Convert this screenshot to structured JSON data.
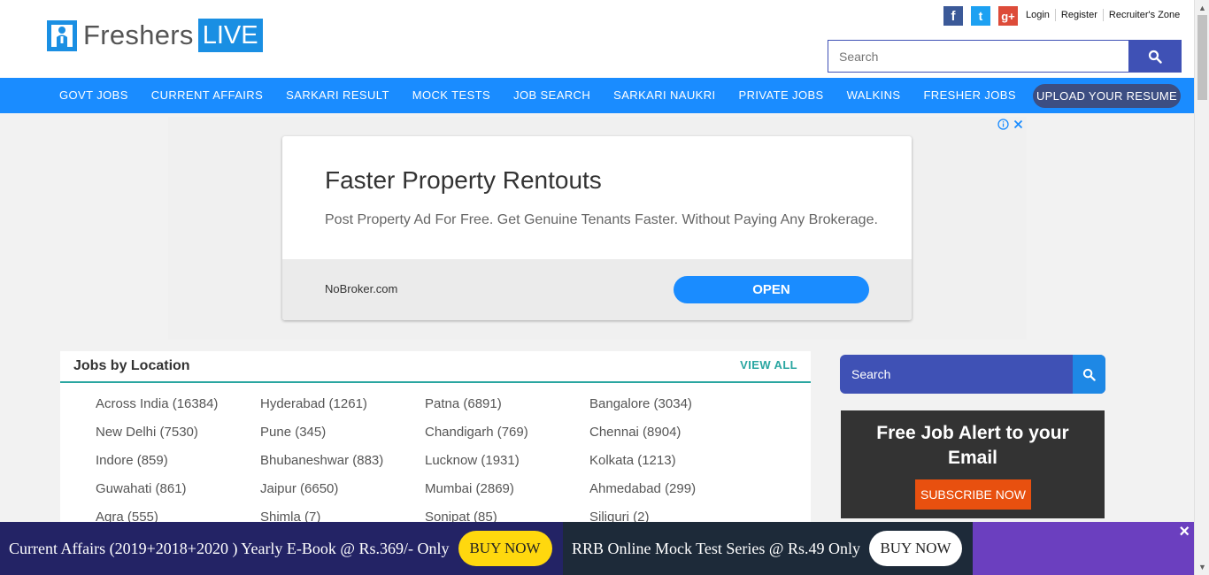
{
  "header": {
    "logo_text": "Freshers",
    "logo_badge": "LIVE",
    "social": [
      "facebook-icon",
      "twitter-icon",
      "google-plus-icon"
    ],
    "social_glyphs": [
      "f",
      "t",
      "g+"
    ],
    "social_colors": [
      "#3b5998",
      "#1da1f2",
      "#dd4b39"
    ],
    "links": [
      "Login",
      "Register",
      "Recruiter's Zone"
    ],
    "search_placeholder": "Search"
  },
  "nav": {
    "items": [
      "GOVT JOBS",
      "CURRENT AFFAIRS",
      "SARKARI RESULT",
      "MOCK TESTS",
      "JOB SEARCH",
      "SARKARI NAUKRI",
      "PRIVATE JOBS",
      "WALKINS",
      "FRESHER JOBS"
    ],
    "upload_label": "UPLOAD YOUR RESUME"
  },
  "ad": {
    "headline": "Faster Property Rentouts",
    "description": "Post Property Ad For Free. Get Genuine Tenants Faster. Without Paying Any Brokerage.",
    "domain": "NoBroker.com",
    "cta": "OPEN"
  },
  "jobs_by_location": {
    "title": "Jobs by Location",
    "view_all": "VIEW ALL",
    "cells": [
      "Across India (16384)",
      "Hyderabad (1261)",
      "Patna (6891)",
      "Bangalore (3034)",
      "New Delhi (7530)",
      "Pune (345)",
      "Chandigarh (769)",
      "Chennai (8904)",
      "Indore (859)",
      "Bhubaneshwar (883)",
      "Lucknow (1931)",
      "Kolkata (1213)",
      "Guwahati (861)",
      "Jaipur (6650)",
      "Mumbai (2869)",
      "Ahmedabad (299)",
      "Agra (555)",
      "Shimla (7)",
      "Sonipat (85)",
      "Siliguri (2)"
    ]
  },
  "sidebar": {
    "search_placeholder": "Search",
    "alert_title": "Free Job Alert to your Email",
    "subscribe_label": "SUBSCRIBE NOW"
  },
  "bottom_bar": {
    "promo1_text": "Current Affairs (2019+2018+2020 ) Yearly E-Book @ Rs.369/- Only",
    "promo1_button": "BUY NOW",
    "promo2_text": "RRB Online Mock Test Series @ Rs.49 Only",
    "promo2_button": "BUY NOW",
    "close_glyph": "×"
  },
  "colors": {
    "nav_bg": "#1a8cff",
    "accent_teal": "#2aa6a1",
    "search_indigo": "#3f51b5",
    "subscribe_orange": "#e8500f",
    "buy1_yellow": "#ffd80e"
  }
}
